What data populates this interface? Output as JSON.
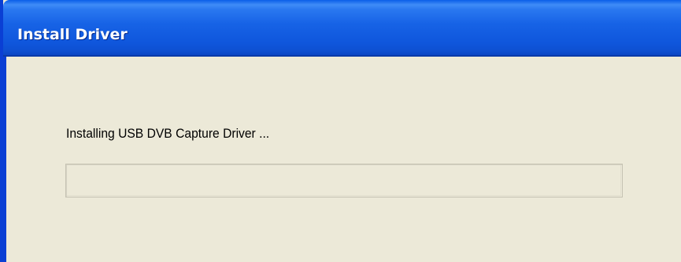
{
  "window": {
    "title": "Install Driver"
  },
  "dialog": {
    "status_text": "Installing USB DVB Capture Driver ...",
    "progress_fraction": 0.0
  },
  "colors": {
    "titlebar_blue": "#0f56dc",
    "window_bg": "#ece9d8",
    "progress_fill": "#2fb349"
  }
}
